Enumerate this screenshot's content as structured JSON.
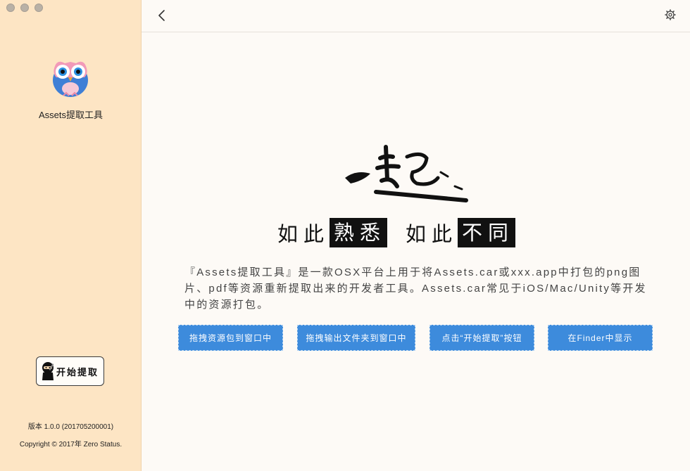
{
  "sidebar": {
    "app_name": "Assets提取工具",
    "start_button_label": "开始提取",
    "version": "版本 1.0.0 (201705200001)",
    "copyright": "Copyright © 2017年 Zero Status."
  },
  "main": {
    "slogan": {
      "part1": "如此",
      "part2": "熟悉",
      "part3": "如此",
      "part4": "不同"
    },
    "description": "『Assets提取工具』是一款OSX平台上用于将Assets.car或xxx.app中打包的png图片、pdf等资源重新提取出来的开发者工具。Assets.car常见于iOS/Mac/Unity等开发中的资源打包。",
    "actions": [
      {
        "label": "拖拽资源包到窗口中"
      },
      {
        "label": "拖拽输出文件夹到窗口中"
      },
      {
        "label": "点击“开始提取”按钮"
      },
      {
        "label": "在Finder中显示"
      }
    ]
  },
  "colors": {
    "sidebar_bg": "#fde5c4",
    "main_bg": "#fdfaf6",
    "accent_blue": "#3d8bdc"
  },
  "icons": [
    "close-icon",
    "minimize-icon",
    "zoom-icon",
    "owl-app-icon",
    "ninja-icon",
    "back-chevron-icon",
    "gear-icon"
  ]
}
